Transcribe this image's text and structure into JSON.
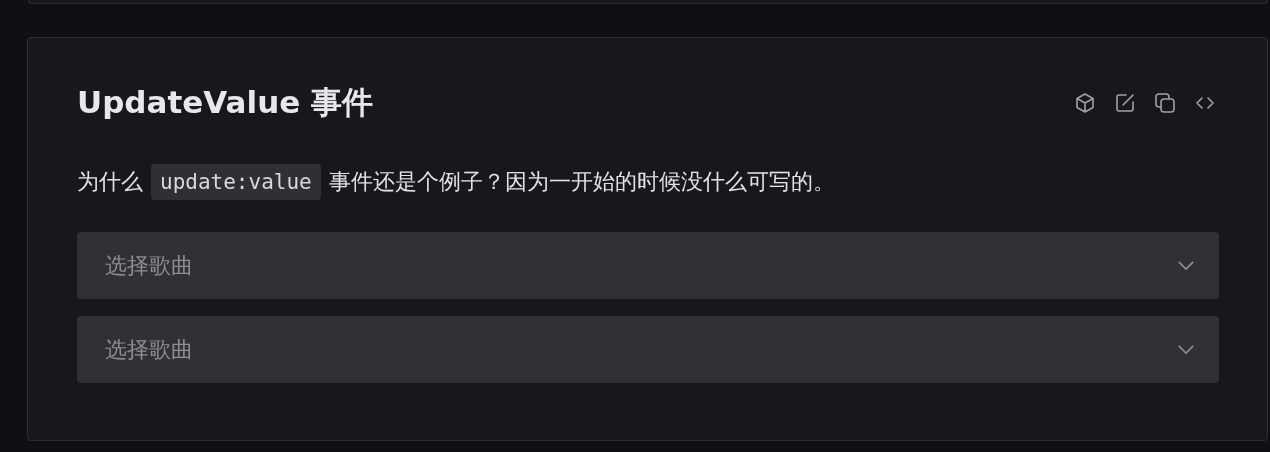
{
  "card": {
    "title": "UpdateValue 事件",
    "description": {
      "before": "为什么",
      "code": "update:value",
      "after": "事件还是个例子？因为一开始的时候没什么可写的。"
    },
    "selects": [
      {
        "placeholder": "选择歌曲"
      },
      {
        "placeholder": "选择歌曲"
      }
    ]
  }
}
